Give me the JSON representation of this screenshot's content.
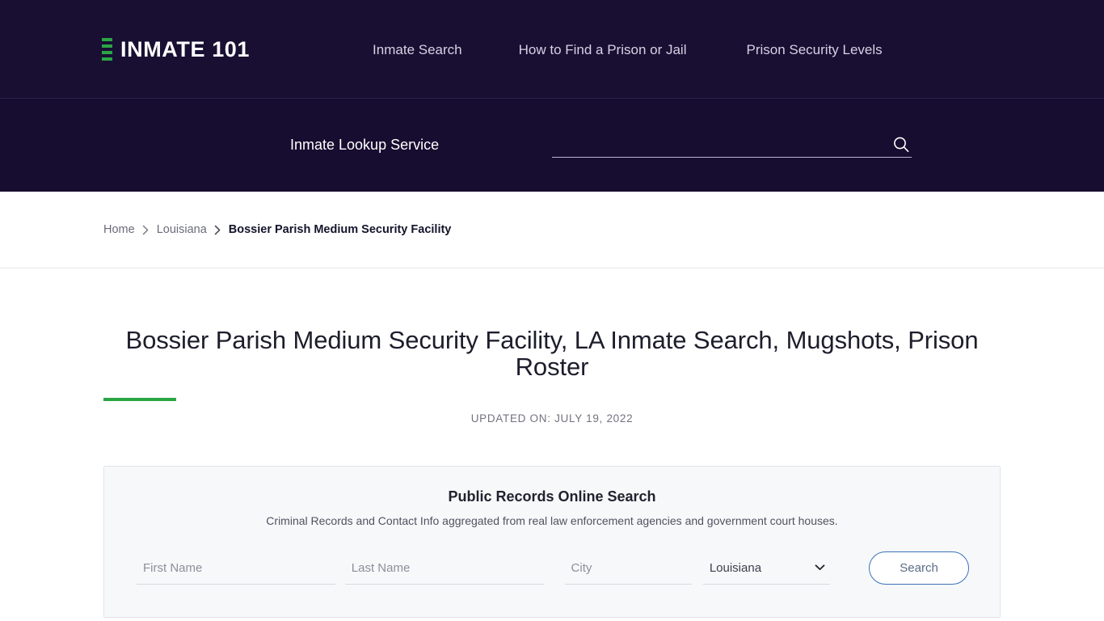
{
  "brand": {
    "name": "INMATE 101",
    "mark_color": "#2aa544"
  },
  "nav": {
    "items": [
      {
        "label": "Inmate Search"
      },
      {
        "label": "How to Find a Prison or Jail"
      },
      {
        "label": "Prison Security Levels"
      }
    ]
  },
  "lookup": {
    "label": "Inmate Lookup Service",
    "input_value": "",
    "input_placeholder": "",
    "icon": "search-icon"
  },
  "breadcrumb": {
    "items": [
      {
        "label": "Home"
      },
      {
        "label": "Louisiana"
      }
    ],
    "separator": "chevron-right-icon",
    "current": "Bossier Parish Medium Security Facility"
  },
  "page": {
    "title": "Bossier Parish Medium Security Facility, LA Inmate Search, Mugshots, Prison Roster",
    "updated": "UPDATED ON: JULY 19, 2022",
    "accent_color": "#2aa544"
  },
  "records_panel": {
    "title": "Public Records Online Search",
    "subtitle": "Criminal Records and Contact Info aggregated from real law enforcement agencies and government court houses.",
    "fields": {
      "first_name": {
        "value": "",
        "placeholder": "First Name"
      },
      "last_name": {
        "value": "",
        "placeholder": "Last Name"
      },
      "city": {
        "value": "",
        "placeholder": "City"
      },
      "state": {
        "selected": "Louisiana",
        "options": [
          "Louisiana"
        ],
        "icon": "chevron-down-icon"
      }
    },
    "submit_label": "Search",
    "submit_border_color": "#3b72b8"
  }
}
